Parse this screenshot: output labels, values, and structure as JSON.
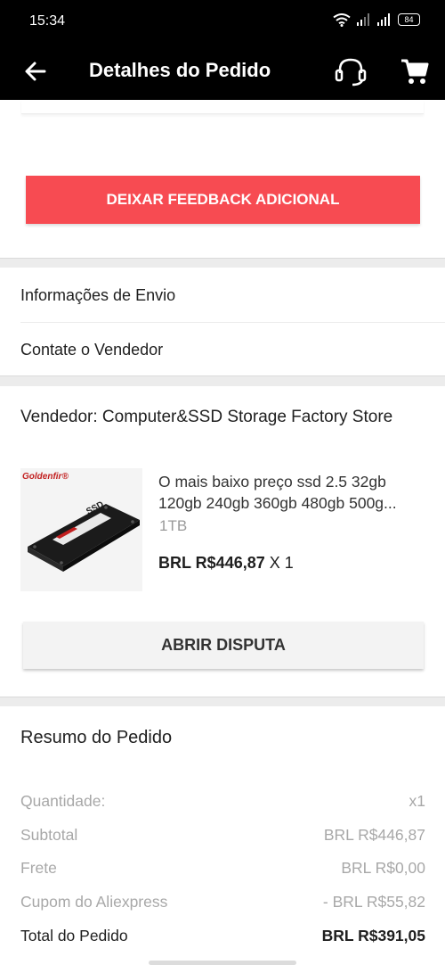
{
  "status_bar": {
    "time": "15:34",
    "battery": "84"
  },
  "app_bar": {
    "title": "Detalhes do Pedido"
  },
  "actions": {
    "feedback_label": "DEIXAR FEEDBACK ADICIONAL",
    "dispute_label": "ABRIR DISPUTA"
  },
  "links": {
    "shipping_info": "Informações de Envio",
    "contact_seller": "Contate o Vendedor"
  },
  "seller": {
    "label": "Vendedor: Computer&SSD Storage Factory Store"
  },
  "product": {
    "brand": "Goldenfir®",
    "image_label": "SSD",
    "title_line1": "O mais baixo preço ssd 2.5 32gb",
    "title_line2": "120gb 240gb 360gb 480gb 500g...",
    "variant": "1TB",
    "price": "BRL R$446,87",
    "quantity": "X 1"
  },
  "summary": {
    "title": "Resumo do Pedido",
    "rows": [
      {
        "label": "Quantidade:",
        "value": "x1"
      },
      {
        "label": "Subtotal",
        "value": "BRL R$446,87"
      },
      {
        "label": "Frete",
        "value": "BRL R$0,00"
      },
      {
        "label": "Cupom do Aliexpress",
        "value": "- BRL R$55,82"
      }
    ],
    "total_label": "Total do Pedido",
    "total_value": "BRL R$391,05"
  },
  "colors": {
    "accent": "#f74b52",
    "header_bg": "#000000"
  },
  "icons": [
    "back-arrow-icon",
    "headset-icon",
    "cart-icon",
    "wifi-icon",
    "signal-icon",
    "battery-icon"
  ]
}
